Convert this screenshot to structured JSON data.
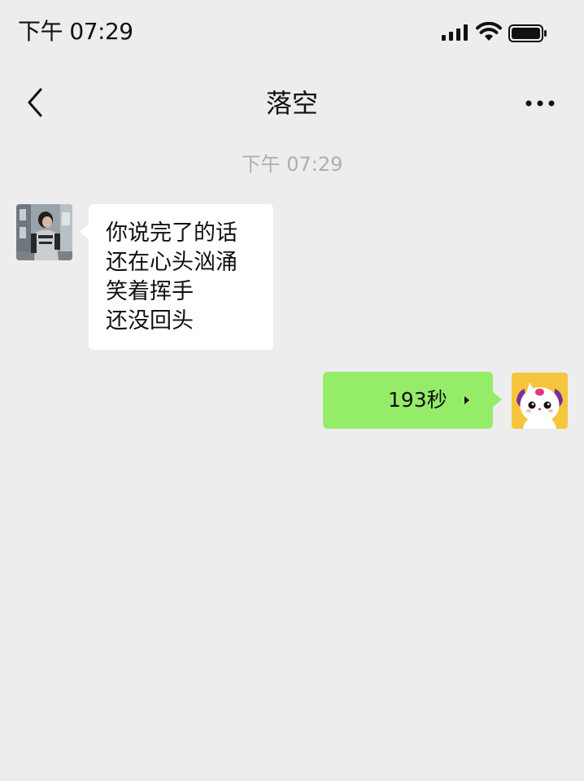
{
  "status_bar": {
    "time": "下午 07:29",
    "signal_icon": "cellular-signal-icon",
    "wifi_icon": "wifi-icon",
    "battery_icon": "battery-icon"
  },
  "header": {
    "title": "落空",
    "back_icon": "chevron-left-icon",
    "more_icon": "more-horizontal-icon"
  },
  "chat": {
    "timestamp": "下午 07:29",
    "messages": [
      {
        "side": "left",
        "type": "text",
        "avatar": "contact-avatar-photo",
        "lines": [
          "你说完了的话",
          "还在心头汹涌",
          "笑着挥手",
          "还没回头"
        ]
      },
      {
        "side": "right",
        "type": "voice",
        "avatar": "self-avatar-cartoon",
        "duration": "193秒"
      }
    ]
  },
  "colors": {
    "background": "#ededed",
    "incoming_bubble": "#ffffff",
    "outgoing_bubble": "#95ec69",
    "timestamp_text": "#aeaeae"
  }
}
